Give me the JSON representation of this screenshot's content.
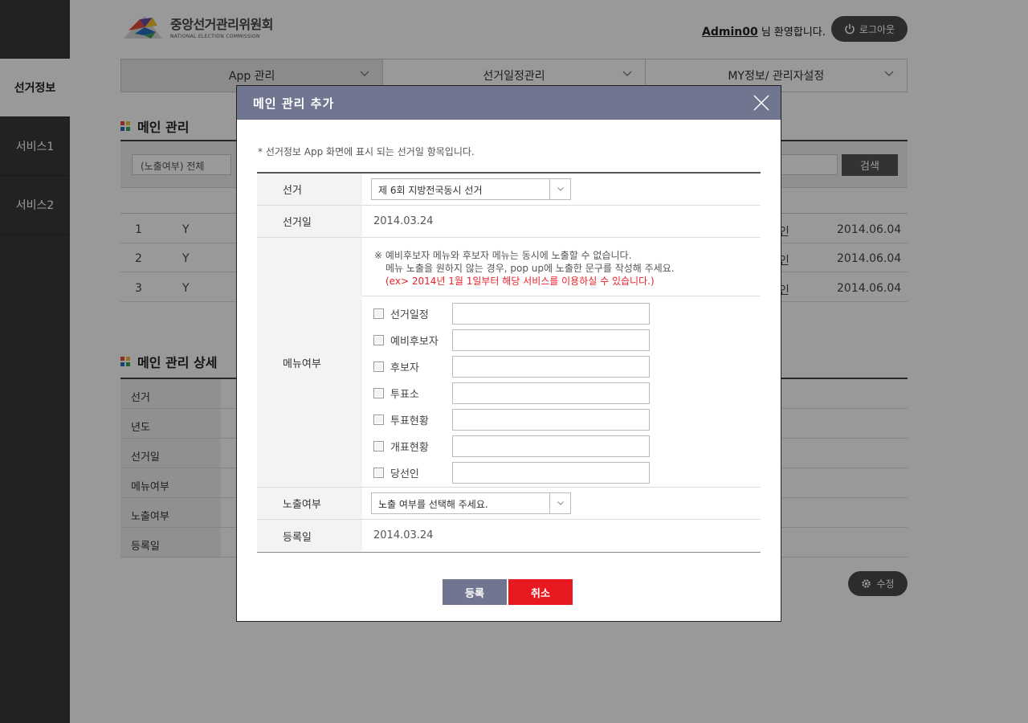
{
  "sidebar": {
    "items": [
      {
        "label": "선거정보",
        "active": true
      },
      {
        "label": "서비스1",
        "active": false
      },
      {
        "label": "서비스2",
        "active": false
      }
    ]
  },
  "header": {
    "brand_ko": "중앙선거관리위원회",
    "brand_en": "NATIONAL ELECTION COMMISSION",
    "user": "Admin00",
    "welcome_suffix": "님 환영합니다.",
    "logout_label": "로그아웃"
  },
  "topnav": [
    {
      "label": "App 관리"
    },
    {
      "label": "선거일정관리"
    },
    {
      "label": "MY정보/ 관리자설정"
    }
  ],
  "main_section": {
    "title": "메인 관리",
    "filter_select": "(노출여부) 전체",
    "search_label": "검색",
    "rows": [
      {
        "no": "1",
        "flag": "Y",
        "tail": "인",
        "date": "2014.06.04"
      },
      {
        "no": "2",
        "flag": "Y",
        "tail": "인",
        "date": "2014.06.04"
      },
      {
        "no": "3",
        "flag": "Y",
        "tail": "인",
        "date": "2014.06.04"
      }
    ]
  },
  "detail_section": {
    "title": "메인 관리 상세",
    "rows": [
      "선거",
      "년도",
      "선거일",
      "메뉴여부",
      "노출여부",
      "등록일"
    ],
    "edit_label": "수정"
  },
  "modal": {
    "title": "메인 관리 추가",
    "note": "* 선거정보 App 화면에 표시 되는 선거일 항목입니다.",
    "fields": {
      "election_label": "선거",
      "election_value": "제 6회 지방전국동시 선거",
      "date_label": "선거일",
      "date_value": "2014.03.24",
      "menu_label": "메뉴여부",
      "menu_note1": "※ 예비후보자 메뉴와 후보자 메뉴는 동시에 노출할 수 없습니다.",
      "menu_note2": "메뉴 노출을 원하지 않는 경우, pop up에 노출한 문구를 작성해 주세요.",
      "menu_note3": "(ex> 2014년 1월 1일부터 해당 서비스를 이용하실 수 있습니다.)",
      "menu_options": [
        "선거일정",
        "예비후보자",
        "후보자",
        "투표소",
        "투표현황",
        "개표현황",
        "당선인"
      ],
      "exposure_label": "노출여부",
      "exposure_placeholder": "노출 여부를 선택해 주세요.",
      "regdate_label": "등록일",
      "regdate_value": "2014.03.24"
    },
    "register_label": "등록",
    "cancel_label": "취소"
  },
  "colors": {
    "modal_header": "#707590",
    "cancel_button": "#e8191f",
    "sidebar_bg": "#3a3a3a",
    "note_red": "#e8232b"
  }
}
